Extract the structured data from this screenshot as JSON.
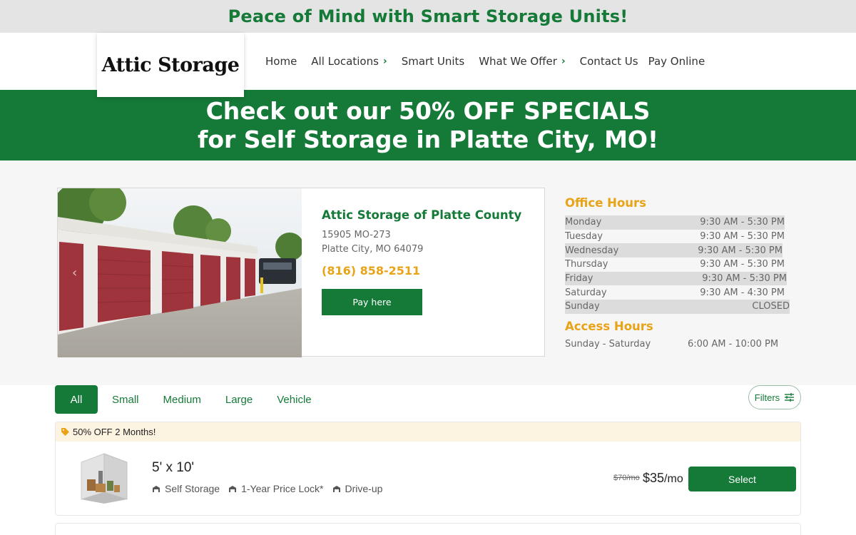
{
  "announcement": {
    "text": "Peace of Mind with Smart Storage Units!"
  },
  "header": {
    "logo_text": "Attic Storage",
    "nav": [
      {
        "label": "Home",
        "has_dropdown": false
      },
      {
        "label": "All Locations",
        "has_dropdown": true
      },
      {
        "label": "Smart Units",
        "has_dropdown": false
      },
      {
        "label": "What We Offer",
        "has_dropdown": true
      },
      {
        "label": "Contact Us",
        "has_dropdown": false
      },
      {
        "label": "Pay Online",
        "has_dropdown": false
      }
    ],
    "chevron": "›"
  },
  "promo": {
    "line1": "Check out our 50% OFF SPECIALS",
    "line2": "for Self Storage in Platte City, MO!"
  },
  "facility": {
    "name": "Attic Storage of Platte County",
    "address_line1": "15905 MO-273",
    "address_line2": "Platte City, MO 64079",
    "phone": "(816) 858-2511",
    "pay_button": "Pay here",
    "photo_prev_icon": "chevron-left-icon"
  },
  "office_hours": {
    "title": "Office Hours",
    "rows": [
      {
        "day": "Monday",
        "hours": "9:30 AM - 5:30 PM"
      },
      {
        "day": "Tuesday",
        "hours": "9:30 AM - 5:30 PM"
      },
      {
        "day": "Wednesday",
        "hours": "9:30 AM - 5:30 PM"
      },
      {
        "day": "Thursday",
        "hours": "9:30 AM - 5:30 PM"
      },
      {
        "day": "Friday",
        "hours": "9:30 AM - 5:30 PM"
      },
      {
        "day": "Saturday",
        "hours": "9:30 AM - 4:30 PM"
      },
      {
        "day": "Sunday",
        "hours": "CLOSED"
      }
    ]
  },
  "access_hours": {
    "title": "Access Hours",
    "days": "Sunday - Saturday",
    "hours": "6:00 AM - 10:00 PM"
  },
  "unit_filters": {
    "tabs": [
      "All",
      "Small",
      "Medium",
      "Large",
      "Vehicle"
    ],
    "active_tab": "All",
    "filters_label": "Filters",
    "filters_icon": "sliders-icon"
  },
  "units": [
    {
      "promo": "50% OFF 2 Months!",
      "promo_icon": "tag-icon",
      "size": "5' x 10'",
      "features": [
        "Self Storage",
        "1-Year Price Lock*",
        "Drive-up"
      ],
      "feature_icon": "garage-icon",
      "old_price": "$70/mo",
      "price": "$35",
      "price_period": "/mo",
      "select_label": "Select"
    }
  ],
  "colors": {
    "brand_green": "#157a38",
    "accent_gold": "#e8a317",
    "promo_strip": "#fdf3e1",
    "door_red": "#a0343c"
  }
}
